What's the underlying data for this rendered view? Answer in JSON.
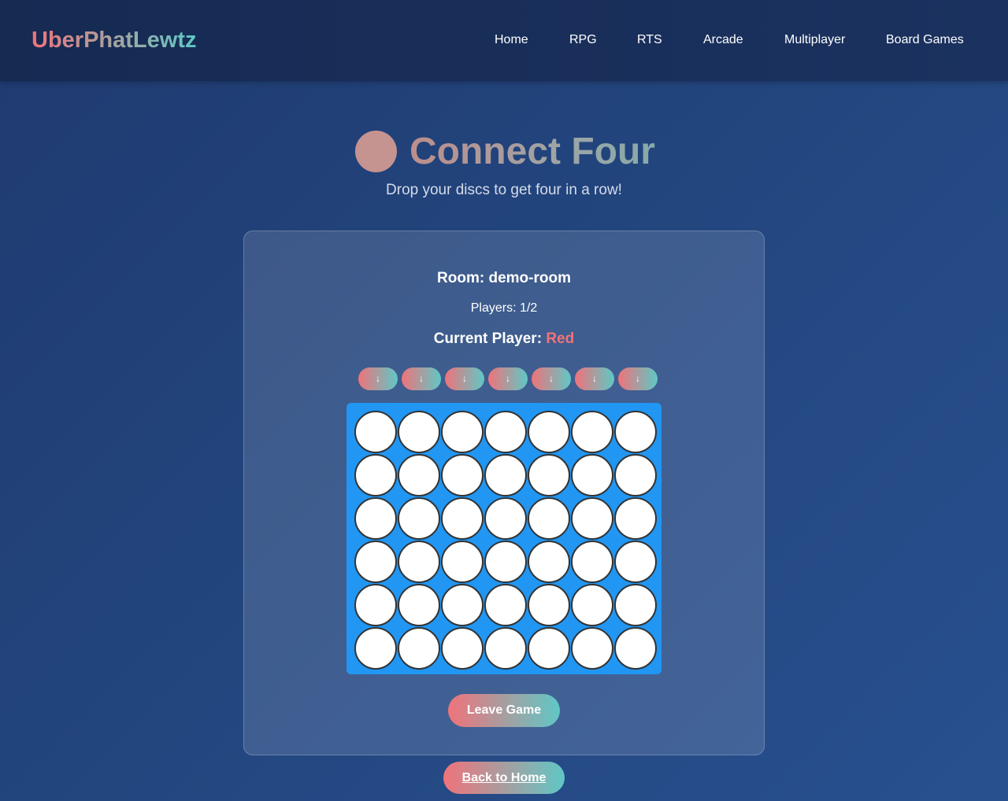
{
  "site": {
    "logo": "UberPhatLewtz",
    "nav": [
      "Home",
      "RPG",
      "RTS",
      "Arcade",
      "Multiplayer",
      "Board Games"
    ]
  },
  "hero": {
    "icon": "disc-icon",
    "title": "Connect Four",
    "subtitle": "Drop your discs to get four in a row!"
  },
  "game": {
    "room": "Room: demo-room",
    "players": "Players: 1/2",
    "current_label": "Current Player:",
    "current_value": "Red",
    "current_color": "#f0737a",
    "drop_glyph": "↓",
    "columns": 7,
    "rows": 6,
    "board": [
      [
        "",
        "",
        "",
        "",
        "",
        "",
        ""
      ],
      [
        "",
        "",
        "",
        "",
        "",
        "",
        ""
      ],
      [
        "",
        "",
        "",
        "",
        "",
        "",
        ""
      ],
      [
        "",
        "",
        "",
        "",
        "",
        "",
        ""
      ],
      [
        "",
        "",
        "",
        "",
        "",
        "",
        ""
      ],
      [
        "",
        "",
        "",
        "",
        "",
        "",
        ""
      ]
    ],
    "board_color": "#2196f3",
    "leave_label": "Leave Game"
  },
  "footer": {
    "back_label": "Back to Home"
  }
}
